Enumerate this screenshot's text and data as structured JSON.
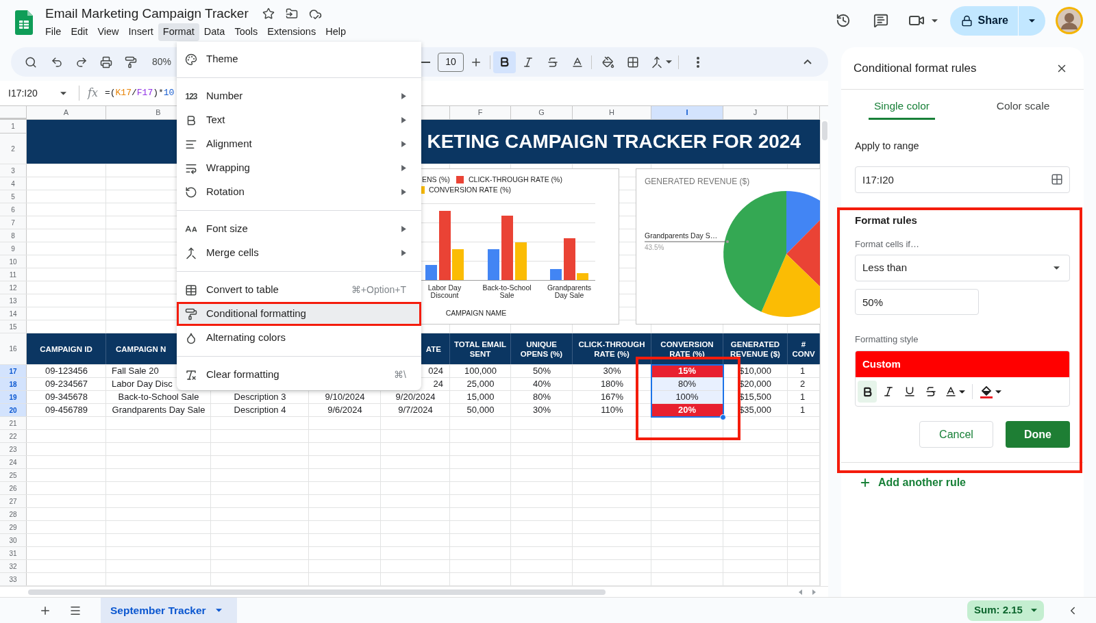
{
  "app": {
    "title": "Email Marketing Campaign Tracker",
    "menus": [
      {
        "label": "File",
        "selected": false
      },
      {
        "label": "Edit",
        "selected": false
      },
      {
        "label": "View",
        "selected": false
      },
      {
        "label": "Insert",
        "selected": false
      },
      {
        "label": "Format",
        "selected": true
      },
      {
        "label": "Data",
        "selected": false
      },
      {
        "label": "Tools",
        "selected": false
      },
      {
        "label": "Extensions",
        "selected": false
      },
      {
        "label": "Help",
        "selected": false
      }
    ],
    "share": "Share"
  },
  "toolbar": {
    "zoom": "80%",
    "font_size": "10",
    "bold": true
  },
  "formula_bar": {
    "name_box": "I17:I20",
    "function_label": "fx",
    "tokens": [
      {
        "text": "=("
      },
      {
        "text": "K17",
        "color": "#e8860c"
      },
      {
        "text": "/"
      },
      {
        "text": "F17",
        "color": "#9334e6"
      },
      {
        "text": ")*"
      },
      {
        "text": "10",
        "color": "#1a5fd0"
      }
    ]
  },
  "format_menu": {
    "sections": [
      [
        {
          "label": "Theme",
          "submenu": false,
          "selected": false
        }
      ],
      [
        {
          "label": "Number",
          "icon_text": "123",
          "submenu": true,
          "selected": false
        },
        {
          "label": "Text",
          "submenu": true,
          "selected": false
        },
        {
          "label": "Alignment",
          "submenu": true,
          "selected": false
        },
        {
          "label": "Wrapping",
          "submenu": true,
          "selected": false
        },
        {
          "label": "Rotation",
          "submenu": true,
          "selected": false
        }
      ],
      [
        {
          "label": "Font size",
          "submenu": true,
          "selected": false
        },
        {
          "label": "Merge cells",
          "submenu": true,
          "selected": false
        }
      ],
      [
        {
          "label": "Convert to table",
          "shortcut": "⌘+Option+T",
          "submenu": false,
          "selected": false
        },
        {
          "label": "Conditional formatting",
          "submenu": false,
          "selected": true
        },
        {
          "label": "Alternating colors",
          "submenu": false,
          "selected": false
        }
      ],
      [
        {
          "label": "Clear formatting",
          "shortcut": "⌘\\",
          "submenu": false,
          "selected": false
        }
      ]
    ]
  },
  "grid": {
    "columns": [
      {
        "label": "A",
        "selected": false
      },
      {
        "label": "B",
        "selected": false
      },
      {
        "selected": false
      },
      {
        "label": "F",
        "selected": false
      },
      {
        "label": "G",
        "selected": false
      },
      {
        "label": "H",
        "selected": false
      },
      {
        "label": "I",
        "selected": true
      },
      {
        "label": "J",
        "selected": false
      },
      {
        "selected": false
      }
    ],
    "rows": [
      {
        "kind": "title",
        "numbers": [
          "1",
          "2"
        ],
        "text": "KETING CAMPAIGN TRACKER FOR 2024"
      },
      {
        "kind": "empty",
        "number": "3"
      },
      {
        "kind": "empty",
        "number": "4"
      },
      {
        "kind": "empty",
        "number": "5"
      },
      {
        "kind": "empty",
        "number": "6"
      },
      {
        "kind": "empty",
        "number": "7"
      },
      {
        "kind": "empty",
        "number": "8"
      },
      {
        "kind": "empty",
        "number": "9"
      },
      {
        "kind": "empty",
        "number": "10"
      },
      {
        "kind": "empty",
        "number": "11"
      },
      {
        "kind": "empty",
        "number": "12"
      },
      {
        "kind": "empty",
        "number": "13"
      },
      {
        "kind": "empty",
        "number": "14"
      },
      {
        "kind": "empty",
        "number": "15"
      },
      {
        "kind": "header",
        "number": "16",
        "cells": {
          "A": "CAMPAIGN ID",
          "B": "CAMPAIGN N",
          "E": "ATE",
          "F": "TOTAL EMAIL SENT",
          "G": "UNIQUE OPENS (%)",
          "H": "CLICK-THROUGH RATE (%)",
          "I": "CONVERSION RATE (%)",
          "J": "GENERATED REVENUE ($)",
          "K": "# CONV"
        }
      },
      {
        "kind": "data",
        "number": "17",
        "selected": true,
        "flagged": true,
        "cells": {
          "A": "09-123456",
          "B": "Fall Sale 20",
          "E": "024",
          "F": "100,000",
          "G": "50%",
          "H": "30%",
          "I": "15%",
          "J": "$10,000",
          "K": "1"
        }
      },
      {
        "kind": "data",
        "number": "18",
        "selected": true,
        "flagged": false,
        "cells": {
          "A": "09-234567",
          "B": "Labor Day Disc",
          "E": "24",
          "F": "25,000",
          "G": "40%",
          "H": "180%",
          "I": "80%",
          "J": "$20,000",
          "K": "2"
        }
      },
      {
        "kind": "data",
        "number": "19",
        "selected": true,
        "flagged": false,
        "cells": {
          "A": "09-345678",
          "B": "Back-to-School Sale",
          "C": "Description 3",
          "D": "9/10/2024",
          "E": "9/20/2024",
          "F": "15,000",
          "G": "80%",
          "H": "167%",
          "I": "100%",
          "J": "$15,500",
          "K": "1"
        }
      },
      {
        "kind": "data",
        "number": "20",
        "selected": true,
        "flagged": true,
        "cells": {
          "A": "09-456789",
          "B": "Grandparents Day Sale",
          "C": "Description 4",
          "D": "9/6/2024",
          "E": "9/7/2024",
          "F": "50,000",
          "G": "30%",
          "H": "110%",
          "I": "20%",
          "J": "$35,000",
          "K": "1"
        }
      },
      {
        "kind": "empty",
        "number": "21"
      },
      {
        "kind": "empty",
        "number": "22"
      },
      {
        "kind": "empty",
        "number": "23"
      },
      {
        "kind": "empty",
        "number": "24"
      },
      {
        "kind": "empty",
        "number": "25"
      },
      {
        "kind": "empty",
        "number": "26"
      },
      {
        "kind": "empty",
        "number": "27"
      },
      {
        "kind": "empty",
        "number": "28"
      },
      {
        "kind": "empty",
        "number": "29"
      },
      {
        "kind": "empty",
        "number": "30"
      },
      {
        "kind": "empty",
        "number": "31"
      },
      {
        "kind": "empty",
        "number": "32"
      },
      {
        "kind": "empty",
        "number": "33"
      }
    ]
  },
  "bar_chart": {
    "legend": [
      {
        "label": "ENS (%)",
        "color": "#4285f4"
      },
      {
        "label": "CLICK-THROUGH RATE (%)",
        "color": "#ea4335"
      },
      {
        "label": "CONVERSION RATE (%)",
        "color": "#fbbc04"
      }
    ],
    "categories": [
      "Labor Day Discount",
      "Back-to-School Sale",
      "Grandparents Day Sale"
    ],
    "xlabel": "CAMPAIGN NAME"
  },
  "pie_chart": {
    "title": "GENERATED REVENUE ($)",
    "label": "Grandparents Day S…",
    "percent": "43.5%"
  },
  "panel": {
    "title": "Conditional format rules",
    "tabs": [
      {
        "label": "Single color",
        "selected": true
      },
      {
        "label": "Color scale",
        "selected": false
      }
    ],
    "range_label": "Apply to range",
    "range": "I17:I20",
    "rules_title": "Format rules",
    "condition_label": "Format cells if…",
    "condition": "Less than",
    "value": "50%",
    "style_label": "Formatting style",
    "style_preview": "Custom",
    "style_bold": true,
    "cancel": "Cancel",
    "done": "Done",
    "add_rule": "Add another rule"
  },
  "bottom_bar": {
    "sheets": [
      {
        "label": "September Tracker",
        "selected": true
      }
    ],
    "sum": "Sum: 2.15"
  }
}
